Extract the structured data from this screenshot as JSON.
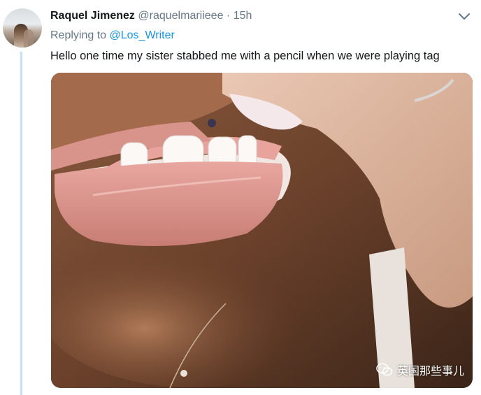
{
  "tweet": {
    "author_name": "Raquel Jimenez",
    "author_handle": "@raquelmariieee",
    "separator": "·",
    "timestamp": "15h",
    "replying_prefix": "Replying to",
    "replying_to": "@Los_Writer",
    "text": "Hello one time my sister stabbed me with a pencil when we were playing tag"
  },
  "icons": {
    "menu": "chevron-down-icon",
    "watermark": "wechat-icon"
  },
  "watermark": {
    "label": "英国那些事儿"
  },
  "colors": {
    "name": "#14171a",
    "secondary": "#657786",
    "link": "#1b95e0",
    "thread_line": "#c4e0f4"
  }
}
